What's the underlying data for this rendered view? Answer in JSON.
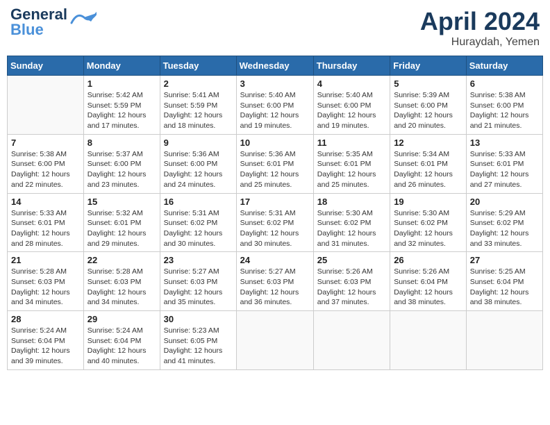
{
  "header": {
    "logo_line1": "General",
    "logo_line2": "Blue",
    "month": "April 2024",
    "location": "Huraydah, Yemen"
  },
  "columns": [
    "Sunday",
    "Monday",
    "Tuesday",
    "Wednesday",
    "Thursday",
    "Friday",
    "Saturday"
  ],
  "weeks": [
    [
      {
        "num": "",
        "info": ""
      },
      {
        "num": "1",
        "info": "Sunrise: 5:42 AM\nSunset: 5:59 PM\nDaylight: 12 hours\nand 17 minutes."
      },
      {
        "num": "2",
        "info": "Sunrise: 5:41 AM\nSunset: 5:59 PM\nDaylight: 12 hours\nand 18 minutes."
      },
      {
        "num": "3",
        "info": "Sunrise: 5:40 AM\nSunset: 6:00 PM\nDaylight: 12 hours\nand 19 minutes."
      },
      {
        "num": "4",
        "info": "Sunrise: 5:40 AM\nSunset: 6:00 PM\nDaylight: 12 hours\nand 19 minutes."
      },
      {
        "num": "5",
        "info": "Sunrise: 5:39 AM\nSunset: 6:00 PM\nDaylight: 12 hours\nand 20 minutes."
      },
      {
        "num": "6",
        "info": "Sunrise: 5:38 AM\nSunset: 6:00 PM\nDaylight: 12 hours\nand 21 minutes."
      }
    ],
    [
      {
        "num": "7",
        "info": "Sunrise: 5:38 AM\nSunset: 6:00 PM\nDaylight: 12 hours\nand 22 minutes."
      },
      {
        "num": "8",
        "info": "Sunrise: 5:37 AM\nSunset: 6:00 PM\nDaylight: 12 hours\nand 23 minutes."
      },
      {
        "num": "9",
        "info": "Sunrise: 5:36 AM\nSunset: 6:00 PM\nDaylight: 12 hours\nand 24 minutes."
      },
      {
        "num": "10",
        "info": "Sunrise: 5:36 AM\nSunset: 6:01 PM\nDaylight: 12 hours\nand 25 minutes."
      },
      {
        "num": "11",
        "info": "Sunrise: 5:35 AM\nSunset: 6:01 PM\nDaylight: 12 hours\nand 25 minutes."
      },
      {
        "num": "12",
        "info": "Sunrise: 5:34 AM\nSunset: 6:01 PM\nDaylight: 12 hours\nand 26 minutes."
      },
      {
        "num": "13",
        "info": "Sunrise: 5:33 AM\nSunset: 6:01 PM\nDaylight: 12 hours\nand 27 minutes."
      }
    ],
    [
      {
        "num": "14",
        "info": "Sunrise: 5:33 AM\nSunset: 6:01 PM\nDaylight: 12 hours\nand 28 minutes."
      },
      {
        "num": "15",
        "info": "Sunrise: 5:32 AM\nSunset: 6:01 PM\nDaylight: 12 hours\nand 29 minutes."
      },
      {
        "num": "16",
        "info": "Sunrise: 5:31 AM\nSunset: 6:02 PM\nDaylight: 12 hours\nand 30 minutes."
      },
      {
        "num": "17",
        "info": "Sunrise: 5:31 AM\nSunset: 6:02 PM\nDaylight: 12 hours\nand 30 minutes."
      },
      {
        "num": "18",
        "info": "Sunrise: 5:30 AM\nSunset: 6:02 PM\nDaylight: 12 hours\nand 31 minutes."
      },
      {
        "num": "19",
        "info": "Sunrise: 5:30 AM\nSunset: 6:02 PM\nDaylight: 12 hours\nand 32 minutes."
      },
      {
        "num": "20",
        "info": "Sunrise: 5:29 AM\nSunset: 6:02 PM\nDaylight: 12 hours\nand 33 minutes."
      }
    ],
    [
      {
        "num": "21",
        "info": "Sunrise: 5:28 AM\nSunset: 6:03 PM\nDaylight: 12 hours\nand 34 minutes."
      },
      {
        "num": "22",
        "info": "Sunrise: 5:28 AM\nSunset: 6:03 PM\nDaylight: 12 hours\nand 34 minutes."
      },
      {
        "num": "23",
        "info": "Sunrise: 5:27 AM\nSunset: 6:03 PM\nDaylight: 12 hours\nand 35 minutes."
      },
      {
        "num": "24",
        "info": "Sunrise: 5:27 AM\nSunset: 6:03 PM\nDaylight: 12 hours\nand 36 minutes."
      },
      {
        "num": "25",
        "info": "Sunrise: 5:26 AM\nSunset: 6:03 PM\nDaylight: 12 hours\nand 37 minutes."
      },
      {
        "num": "26",
        "info": "Sunrise: 5:26 AM\nSunset: 6:04 PM\nDaylight: 12 hours\nand 38 minutes."
      },
      {
        "num": "27",
        "info": "Sunrise: 5:25 AM\nSunset: 6:04 PM\nDaylight: 12 hours\nand 38 minutes."
      }
    ],
    [
      {
        "num": "28",
        "info": "Sunrise: 5:24 AM\nSunset: 6:04 PM\nDaylight: 12 hours\nand 39 minutes."
      },
      {
        "num": "29",
        "info": "Sunrise: 5:24 AM\nSunset: 6:04 PM\nDaylight: 12 hours\nand 40 minutes."
      },
      {
        "num": "30",
        "info": "Sunrise: 5:23 AM\nSunset: 6:05 PM\nDaylight: 12 hours\nand 41 minutes."
      },
      {
        "num": "",
        "info": ""
      },
      {
        "num": "",
        "info": ""
      },
      {
        "num": "",
        "info": ""
      },
      {
        "num": "",
        "info": ""
      }
    ]
  ]
}
